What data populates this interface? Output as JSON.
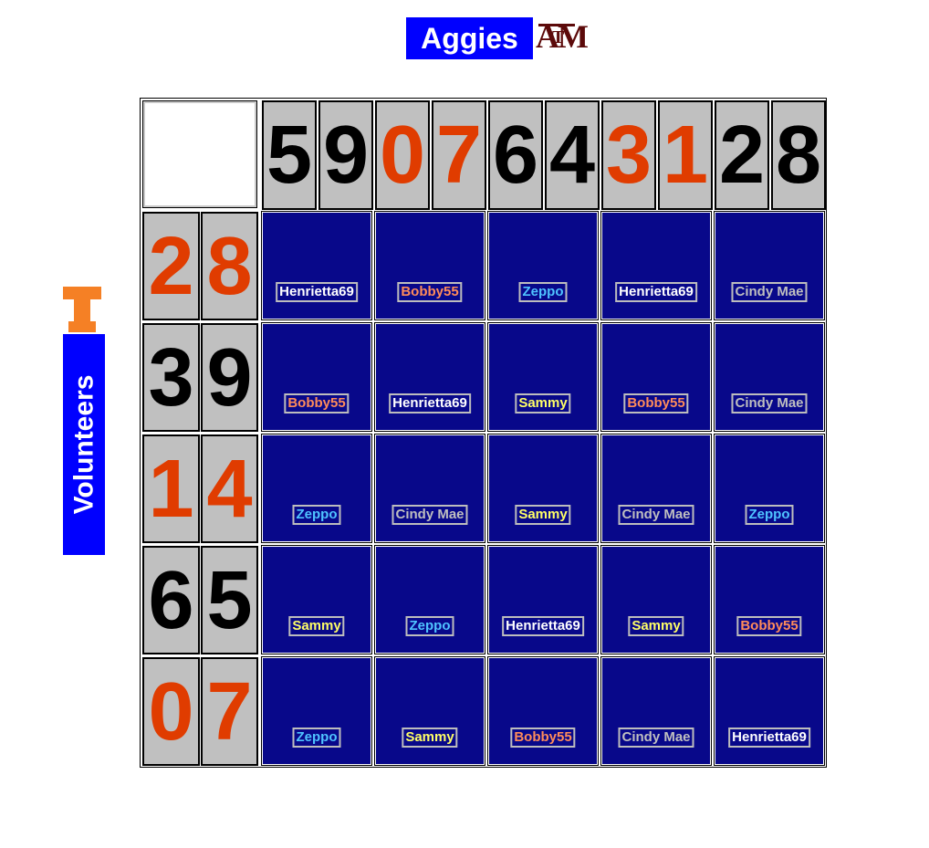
{
  "top_team": {
    "name": "Aggies",
    "logo": "tamu-logo",
    "logo_text": "ATM"
  },
  "left_team": {
    "name": "Volunteers",
    "logo": "tennessee-t-logo"
  },
  "colors": {
    "team_label_bg": "#0000ff",
    "cell_bg": "#08088a",
    "digit_bg": "#c0c0c0",
    "digit_dark": "#000000",
    "digit_orange": "#e03c00",
    "tn_orange": "#f58025",
    "tamu_maroon": "#5c0a0a"
  },
  "top_digits": [
    {
      "value": "5",
      "color": "#000000"
    },
    {
      "value": "9",
      "color": "#000000"
    },
    {
      "value": "0",
      "color": "#e03c00"
    },
    {
      "value": "7",
      "color": "#e03c00"
    },
    {
      "value": "6",
      "color": "#000000"
    },
    {
      "value": "4",
      "color": "#000000"
    },
    {
      "value": "3",
      "color": "#e03c00"
    },
    {
      "value": "1",
      "color": "#e03c00"
    },
    {
      "value": "2",
      "color": "#000000"
    },
    {
      "value": "8",
      "color": "#000000"
    }
  ],
  "left_digits": [
    [
      {
        "value": "2",
        "color": "#e03c00"
      },
      {
        "value": "8",
        "color": "#e03c00"
      }
    ],
    [
      {
        "value": "3",
        "color": "#000000"
      },
      {
        "value": "9",
        "color": "#000000"
      }
    ],
    [
      {
        "value": "1",
        "color": "#e03c00"
      },
      {
        "value": "4",
        "color": "#e03c00"
      }
    ],
    [
      {
        "value": "6",
        "color": "#000000"
      },
      {
        "value": "5",
        "color": "#000000"
      }
    ],
    [
      {
        "value": "0",
        "color": "#e03c00"
      },
      {
        "value": "7",
        "color": "#e03c00"
      }
    ]
  ],
  "player_colors": {
    "Henrietta69": "#ffffff",
    "Bobby55": "#ff8c5a",
    "Zeppo": "#4fc3ff",
    "Cindy Mae": "#bfbfbf",
    "Sammy": "#ffff66"
  },
  "grid": [
    [
      "Henrietta69",
      "Bobby55",
      "Zeppo",
      "Henrietta69",
      "Cindy Mae"
    ],
    [
      "Bobby55",
      "Henrietta69",
      "Sammy",
      "Bobby55",
      "Cindy Mae"
    ],
    [
      "Zeppo",
      "Cindy Mae",
      "Sammy",
      "Cindy Mae",
      "Zeppo"
    ],
    [
      "Sammy",
      "Zeppo",
      "Henrietta69",
      "Sammy",
      "Bobby55"
    ],
    [
      "Zeppo",
      "Sammy",
      "Bobby55",
      "Cindy Mae",
      "Henrietta69"
    ]
  ]
}
